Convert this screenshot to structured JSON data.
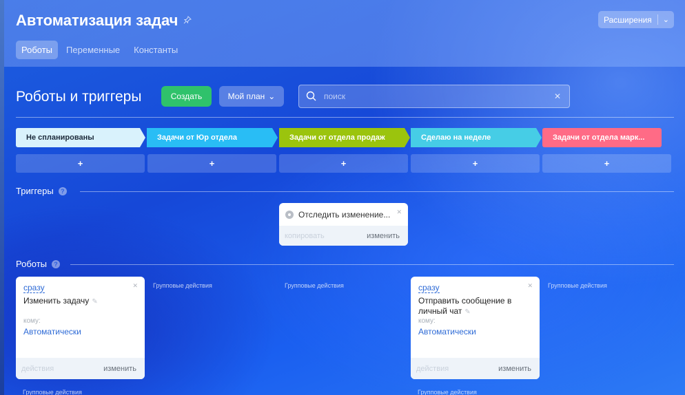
{
  "header": {
    "title": "Автоматизация задач",
    "tabs": [
      {
        "label": "Роботы",
        "active": true
      },
      {
        "label": "Переменные",
        "active": false
      },
      {
        "label": "Константы",
        "active": false
      }
    ],
    "extensions_label": "Расширения"
  },
  "toolbar": {
    "page_title": "Роботы и триггеры",
    "create_label": "Создать",
    "plan_label": "Мой план",
    "search_placeholder": "поиск"
  },
  "stages": [
    {
      "label": "Не спланированы",
      "color": "#d9f2fc",
      "text_color": "#1c2a3a"
    },
    {
      "label": "Задачи от Юр отдела",
      "color": "#29bdf5",
      "text_color": "#ffffff"
    },
    {
      "label": "Задачи от отдела продаж",
      "color": "#9bc40d",
      "text_color": "#ffffff"
    },
    {
      "label": "Сделаю на неделе",
      "color": "#46cde6",
      "text_color": "#ffffff"
    },
    {
      "label": "Задачи от отдела марк...",
      "color": "#ff6b86",
      "text_color": "#ffffff"
    }
  ],
  "add_symbol": "+",
  "triggers": {
    "section_label": "Триггеры",
    "help": "?",
    "card": {
      "title": "Отследить изменение...",
      "copy_label": "копировать",
      "edit_label": "изменить"
    }
  },
  "robots": {
    "section_label": "Роботы",
    "help": "?",
    "cards": [
      {
        "when": "сразу",
        "name": "Изменить задачу",
        "to_label": "кому:",
        "to_value": "Автоматически",
        "actions_label": "действия",
        "edit_label": "изменить"
      },
      {
        "when": "сразу",
        "name": "Отправить сообщение в личный чат",
        "to_label": "кому:",
        "to_value": "Автоматически",
        "actions_label": "действия",
        "edit_label": "изменить"
      }
    ],
    "group_actions_label": "Групповые действия"
  }
}
